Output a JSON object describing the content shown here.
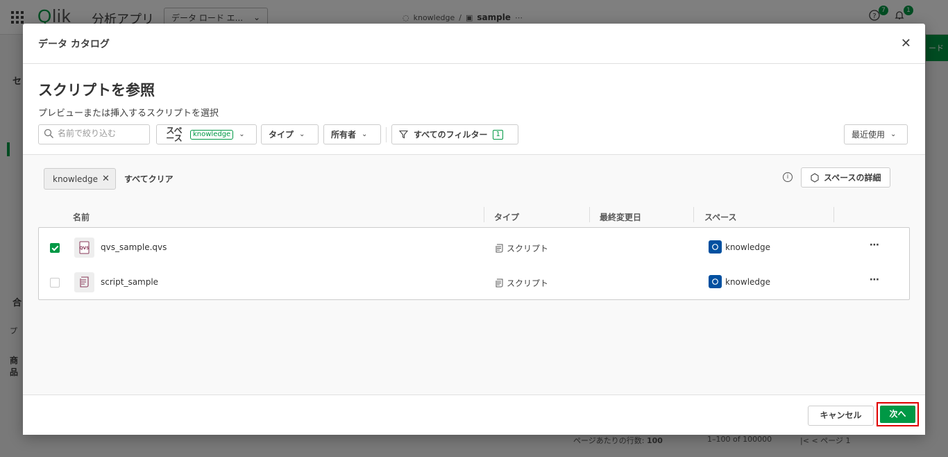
{
  "app": {
    "logo": "Qlik",
    "title": "分析アプリ",
    "view_dropdown": "データ ロード エ...",
    "breadcrumb_space": "knowledge",
    "breadcrumb_sep": "/",
    "breadcrumb_app": "sample",
    "help_badge": "7",
    "notify_badge": "1",
    "right_button_fragment": "ード",
    "left_fragments": [
      "セ",
      "合",
      "プ",
      "商品"
    ],
    "pagination": {
      "rows_per_page_label": "ページあたりの行数:",
      "rows_per_page_value": "100",
      "range": "1–100 of 100000",
      "page_label": "ページ",
      "page_value": "1"
    }
  },
  "modal": {
    "title": "データ カタログ",
    "heading": "スクリプトを参照",
    "subheading": "プレビューまたは挿入するスクリプトを選択",
    "search_placeholder": "名前で絞り込む",
    "filters": {
      "space_label": "スペース",
      "space_tag": "knowledge",
      "type_label": "タイプ",
      "owner_label": "所有者",
      "all_filters_label": "すべてのフィルター",
      "all_filters_count": "1",
      "sort_label": "最近使用"
    },
    "chip_label": "knowledge",
    "clear_all": "すべてクリア",
    "space_detail_button": "スペースの詳細",
    "columns": [
      "名前",
      "タイプ",
      "最終変更日",
      "スペース"
    ],
    "rows": [
      {
        "checked": true,
        "name": "qvs_sample.qvs",
        "type": "スクリプト",
        "modified": "",
        "space": "knowledge",
        "icon": "qvs-file-icon"
      },
      {
        "checked": false,
        "name": "script_sample",
        "type": "スクリプト",
        "modified": "",
        "space": "knowledge",
        "icon": "script-file-icon"
      }
    ],
    "cancel_button": "キャンセル",
    "next_button": "次へ"
  },
  "colors": {
    "accent": "#009845",
    "space_icon": "#0050a0",
    "highlight": "#e00000"
  }
}
